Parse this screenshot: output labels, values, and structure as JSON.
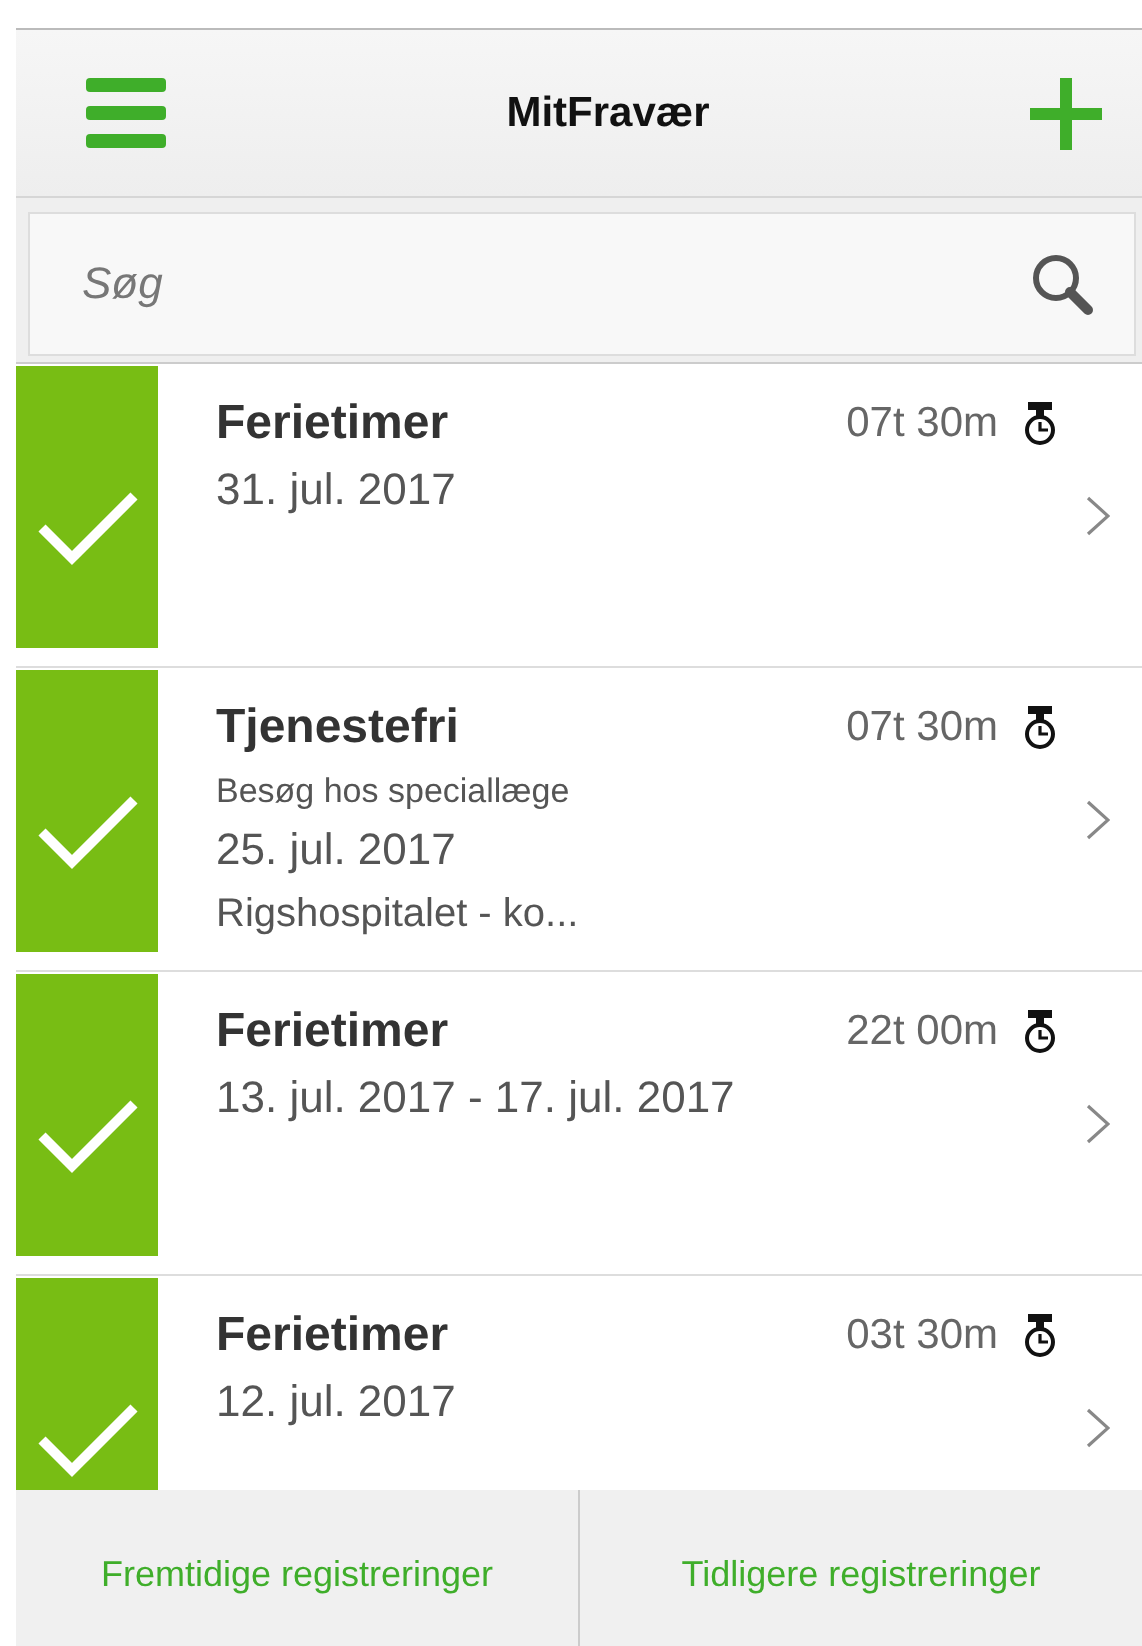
{
  "header": {
    "title": "MitFravær"
  },
  "search": {
    "placeholder": "Søg"
  },
  "entries": [
    {
      "type": "Ferietimer",
      "date": "31. jul. 2017",
      "duration": "07t 30m",
      "approved": true
    },
    {
      "type": "Tjenestefri",
      "note": "Besøg hos speciallæge",
      "date": "25. jul. 2017",
      "place": "Rigshospitalet - ko...",
      "duration": "07t 30m",
      "approved": true
    },
    {
      "type": "Ferietimer",
      "date": "13. jul. 2017 - 17. jul. 2017",
      "duration": "22t 00m",
      "approved": true
    },
    {
      "type": "Ferietimer",
      "date": "12. jul. 2017",
      "duration": "03t 30m",
      "approved": true
    }
  ],
  "footer_tabs": [
    {
      "label": "Fremtidige registreringer"
    },
    {
      "label": "Tidligere registreringer"
    }
  ]
}
